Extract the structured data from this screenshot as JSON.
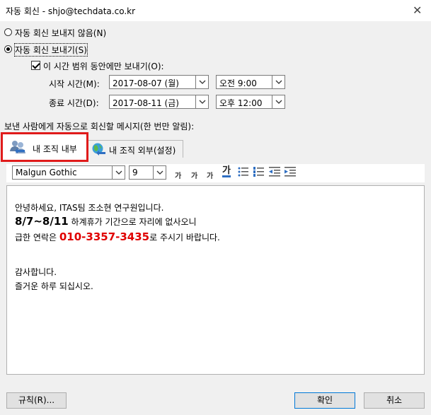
{
  "window": {
    "title": "자동 회신 - shjo@techdata.co.kr"
  },
  "options": {
    "no_reply_label": "자동 회신 보내지 않음(N)",
    "send_reply_label": "자동 회신 보내기(S)",
    "time_range_label": "이 시간 범위 동안에만 보내기(O):"
  },
  "schedule": {
    "start_label": "시작 시간(M):",
    "start_date": "2017-08-07 (월)",
    "start_time": "오전 9:00",
    "end_label": "종료 시간(D):",
    "end_date": "2017-08-11 (금)",
    "end_time": "오후 12:00"
  },
  "message_label": "보낸 사람에게 자동으로 회신할 메시지(한 번만 알림):",
  "tabs": [
    {
      "label": "내 조직 내부"
    },
    {
      "label": "내 조직 외부(설정)"
    }
  ],
  "toolbar": {
    "font": "Malgun Gothic",
    "size": "9",
    "grow_glyph": "가",
    "shrink_glyph": "가",
    "bold_glyph": "가",
    "color_glyph": "가"
  },
  "message": {
    "line1": "안녕하세요, ITAS팀 조소현 연구원입니다.",
    "line2_bold": "8/7~8/11",
    "line2_rest": " 하계휴가 기간으로 자리에 없사오니",
    "line3_pre": "급한 연락은 ",
    "line3_phone": "010-3357-3435",
    "line3_post": "로 주시기 바랍니다.",
    "line4": "감사합니다.",
    "line5": "즐거운 하루 되십시오."
  },
  "buttons": {
    "rules": "규칙(R)...",
    "ok": "확인",
    "cancel": "취소"
  },
  "colors": {
    "highlight": "#e01b1b",
    "accent": "#0078d7"
  }
}
